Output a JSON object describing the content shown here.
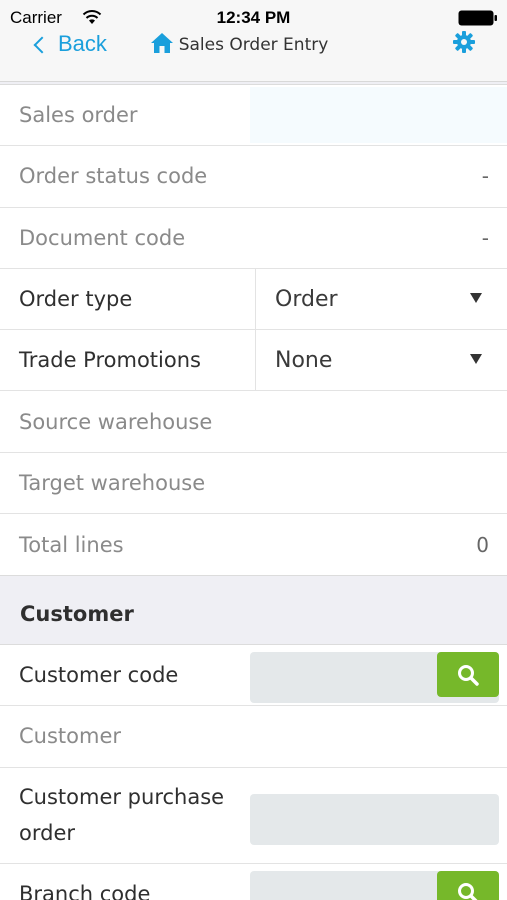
{
  "status_bar": {
    "carrier": "Carrier",
    "time": "12:34 PM"
  },
  "nav": {
    "back_label": "Back",
    "title": "Sales Order Entry"
  },
  "header_fields": [
    {
      "label": "Sales order",
      "value": ""
    },
    {
      "label": "Order status code",
      "value": "-"
    },
    {
      "label": "Document code",
      "value": "-"
    },
    {
      "label": "Order type",
      "value": "Order"
    },
    {
      "label": "Trade Promotions",
      "value": "None"
    },
    {
      "label": "Source warehouse",
      "value": ""
    },
    {
      "label": "Target warehouse",
      "value": ""
    },
    {
      "label": "Total lines",
      "value": "0"
    }
  ],
  "customer_section": {
    "title": "Customer",
    "fields": [
      {
        "label": "Customer code",
        "value": ""
      },
      {
        "label": "Customer",
        "value": ""
      },
      {
        "label": "Customer purchase order",
        "value": ""
      },
      {
        "label": "Branch code",
        "value": ""
      }
    ]
  },
  "colors": {
    "accent": "#1a9fdc",
    "lookup_button": "#76b82a"
  }
}
